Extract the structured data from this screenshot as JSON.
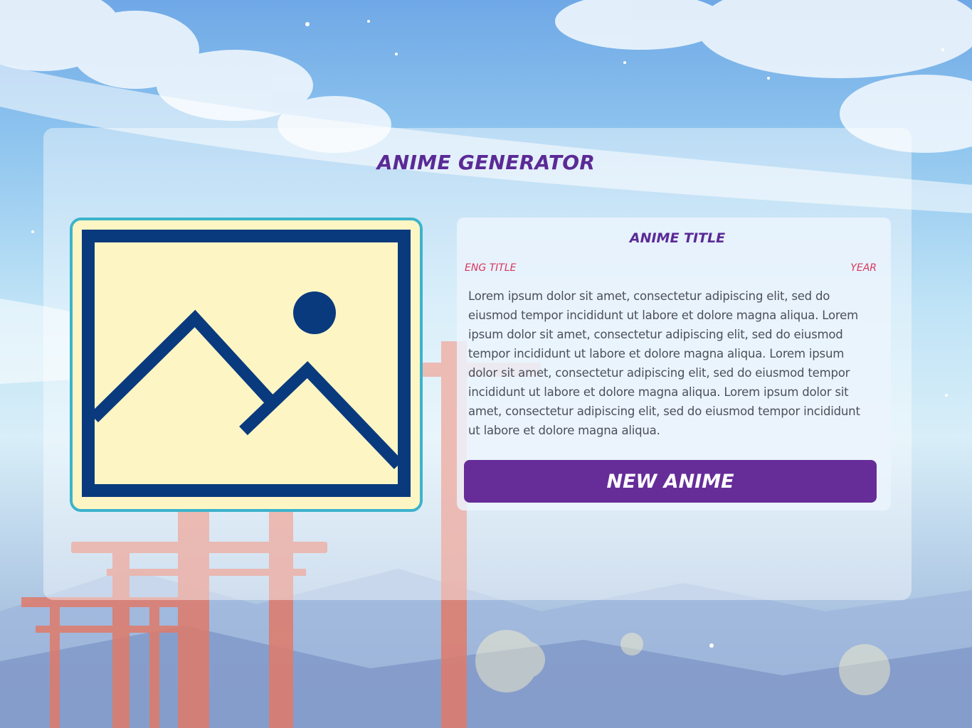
{
  "app": {
    "title": "ANIME GENERATOR"
  },
  "image": {
    "icon": "image-placeholder-icon"
  },
  "anime": {
    "title": "ANIME TITLE",
    "eng_title": "ENG TITLE",
    "year": "YEAR",
    "synopsis": "Lorem ipsum dolor sit amet, consectetur adipiscing elit, sed do eiusmod tempor incididunt ut labore et dolore magna aliqua. Lorem ipsum dolor sit amet, consectetur adipiscing elit, sed do eiusmod tempor incididunt ut labore et dolore magna aliqua. Lorem ipsum dolor sit amet, consectetur adipiscing elit, sed do eiusmod tempor incididunt ut labore et dolore magna aliqua. Lorem ipsum dolor sit amet, consectetur adipiscing elit, sed do eiusmod tempor incididunt ut labore et dolore magna aliqua."
  },
  "actions": {
    "new_anime_label": "NEW ANIME"
  },
  "colors": {
    "accent": "#662d99",
    "title": "#5b2a96",
    "meta": "#d9365b",
    "image_border": "#3cb3cc",
    "image_bg": "#fdf6c4",
    "icon_stroke": "#0a3a7e"
  }
}
